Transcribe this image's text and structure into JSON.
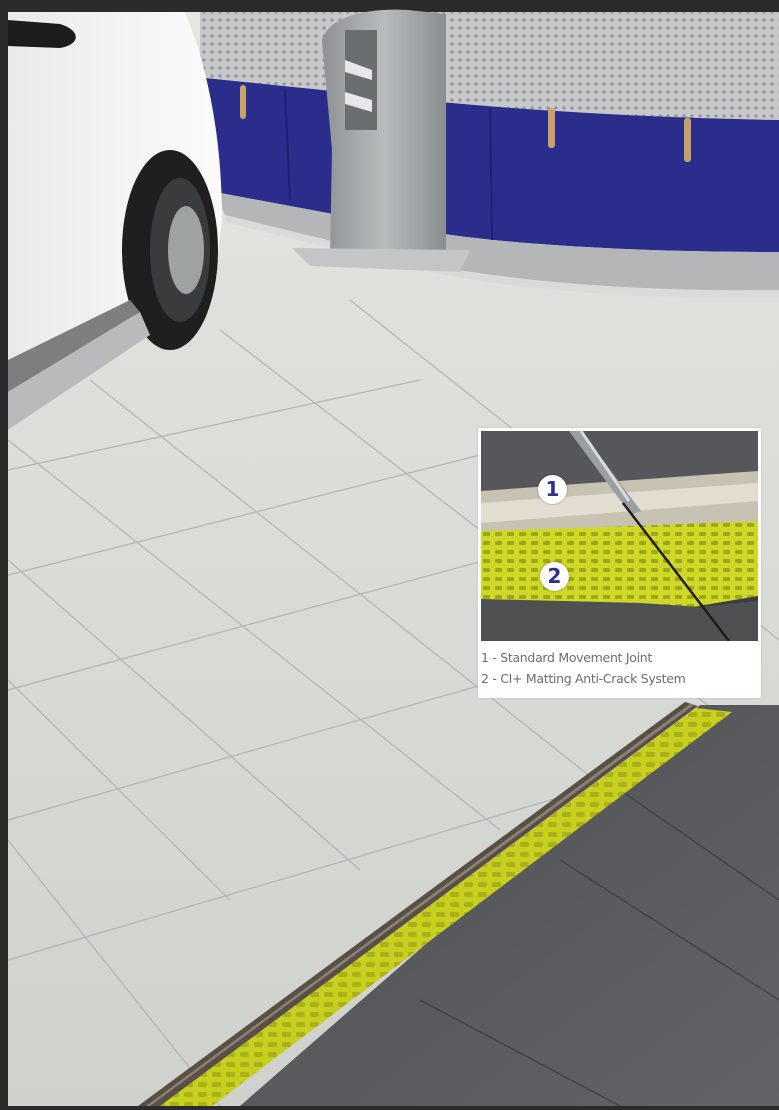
{
  "scene": {
    "colors": {
      "floor_tile": "#dcded9",
      "dark_tile": "#55575a",
      "matting_yellow": "#c9d21e",
      "counter_blue": "#2a2d8c",
      "frame_top": "#2b2b2b"
    }
  },
  "inset": {
    "badges": [
      "1",
      "2"
    ],
    "badge_color": "#2e2f8e",
    "legend": [
      "1 - Standard Movement Joint",
      "2 - CI+ Matting Anti-Crack System"
    ]
  }
}
